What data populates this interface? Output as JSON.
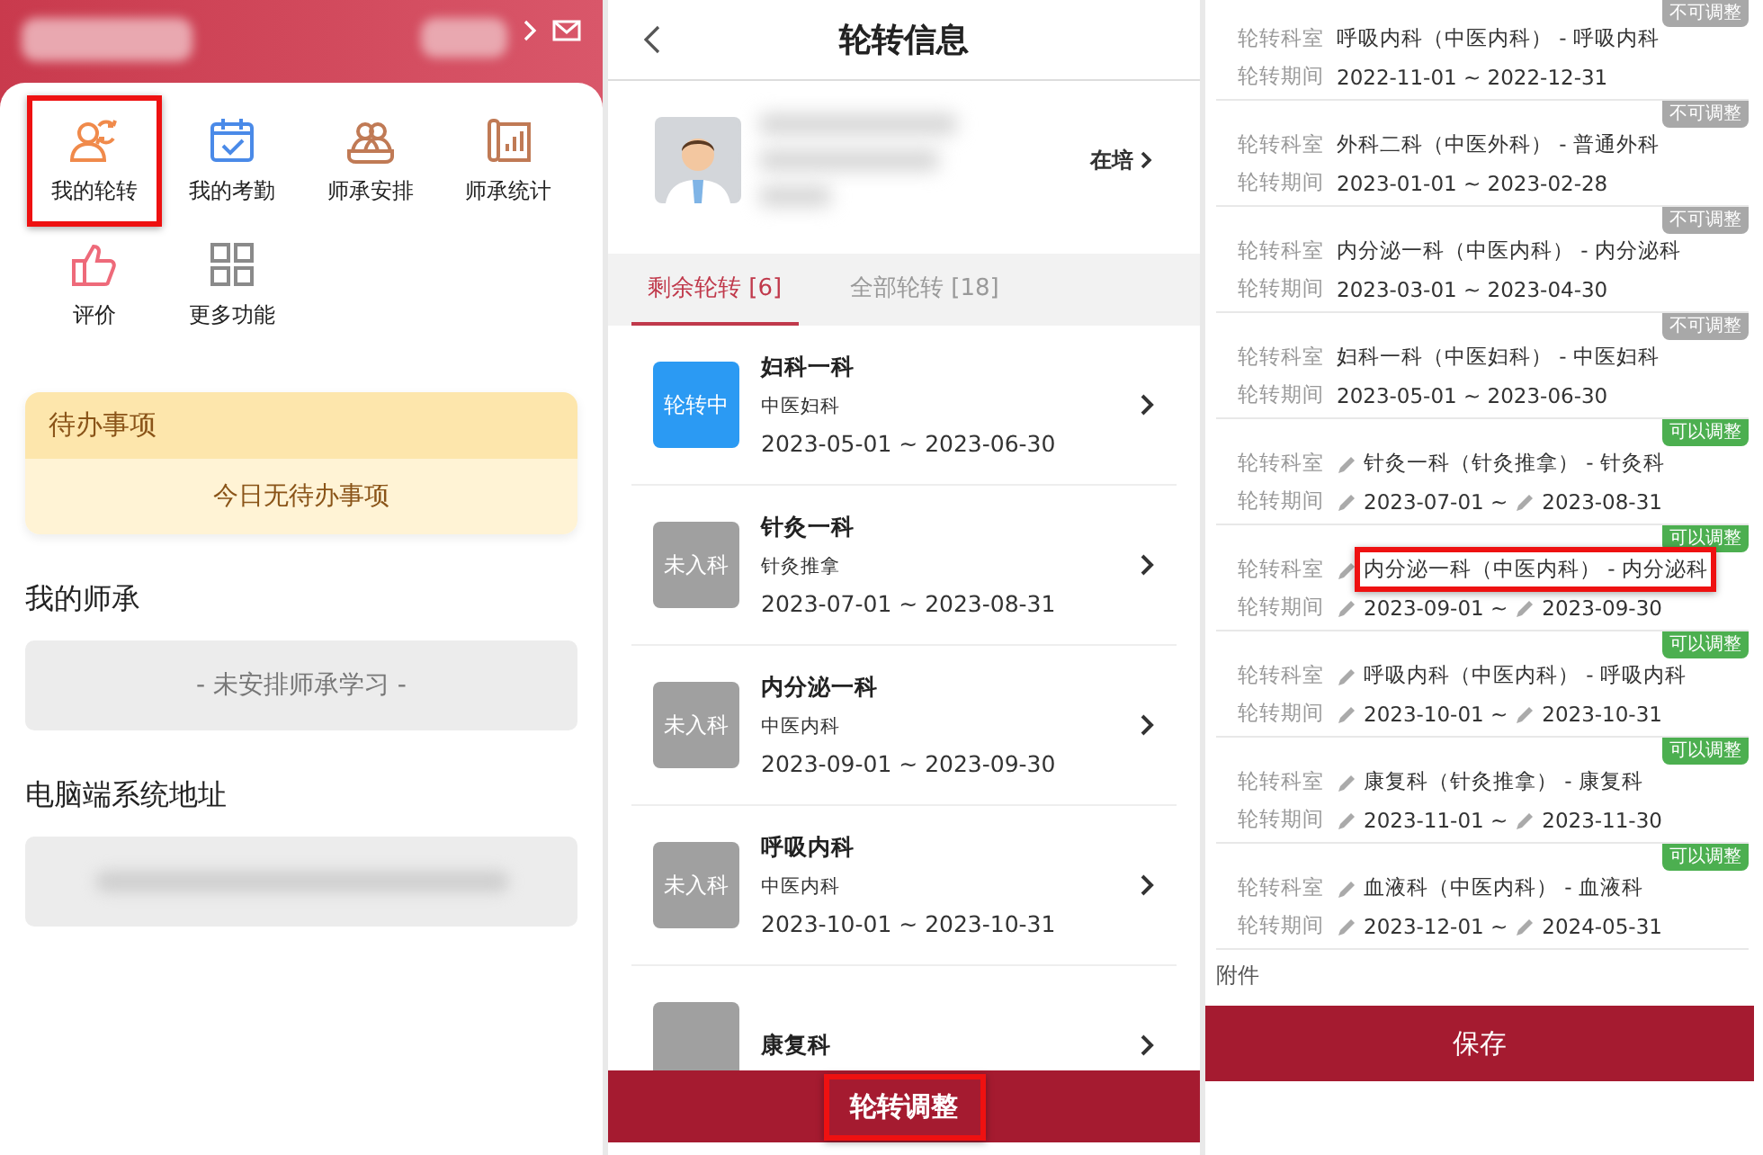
{
  "home": {
    "quick_actions": [
      {
        "label": "我的轮转",
        "highlighted": true
      },
      {
        "label": "我的考勤",
        "highlighted": false
      },
      {
        "label": "师承安排",
        "highlighted": false
      },
      {
        "label": "师承统计",
        "highlighted": false
      },
      {
        "label": "评价",
        "highlighted": false
      },
      {
        "label": "更多功能",
        "highlighted": false
      }
    ],
    "todo": {
      "title": "待办事项",
      "message": "今日无待办事项"
    },
    "mentorship": {
      "title": "我的师承",
      "message": "- 未安排师承学习 -"
    },
    "pc_address": {
      "title": "电脑端系统地址"
    }
  },
  "rotation_info": {
    "title": "轮转信息",
    "status_link": "在培",
    "tabs": [
      {
        "label": "剩余轮转 [6]",
        "selected": true
      },
      {
        "label": "全部轮转 [18]",
        "selected": false
      }
    ],
    "items": [
      {
        "kind": "current",
        "status_label": "轮转中",
        "name": "妇科一科",
        "category": "中医妇科",
        "period": "2023-05-01 ~ 2023-06-30"
      },
      {
        "kind": "pending",
        "status_label": "未入科",
        "name": "针灸一科",
        "category": "针灸推拿",
        "period": "2023-07-01 ~ 2023-08-31"
      },
      {
        "kind": "pending",
        "status_label": "未入科",
        "name": "内分泌一科",
        "category": "中医内科",
        "period": "2023-09-01 ~ 2023-09-30"
      },
      {
        "kind": "pending",
        "status_label": "未入科",
        "name": "呼吸内科",
        "category": "中医内科",
        "period": "2023-10-01 ~ 2023-10-31"
      },
      {
        "kind": "pending",
        "name": "康复科"
      }
    ],
    "adjust_button": {
      "label": "轮转调整",
      "highlighted": true
    }
  },
  "rotation_adjust": {
    "rows": [
      {
        "adjustable": false,
        "badge": "不可调整",
        "dept_label": "轮转科室",
        "dept": "呼吸内科（中医内科） - 呼吸内科",
        "period_label": "轮转期间",
        "period": "2022-11-01 ~ 2022-12-31",
        "highlighted": false
      },
      {
        "adjustable": false,
        "badge": "不可调整",
        "dept_label": "轮转科室",
        "dept": "外科二科（中医外科） - 普通外科",
        "period_label": "轮转期间",
        "period": "2023-01-01 ~ 2023-02-28",
        "highlighted": false
      },
      {
        "adjustable": false,
        "badge": "不可调整",
        "dept_label": "轮转科室",
        "dept": "内分泌一科（中医内科） - 内分泌科",
        "period_label": "轮转期间",
        "period": "2023-03-01 ~ 2023-04-30",
        "highlighted": false
      },
      {
        "adjustable": false,
        "badge": "不可调整",
        "dept_label": "轮转科室",
        "dept": "妇科一科（中医妇科） - 中医妇科",
        "period_label": "轮转期间",
        "period": "2023-05-01 ~ 2023-06-30",
        "highlighted": false
      },
      {
        "adjustable": true,
        "badge": "可以调整",
        "dept_label": "轮转科室",
        "dept": "针灸一科（针灸推拿） - 针灸科",
        "period_label": "轮转期间",
        "period_parts": [
          "2023-07-01 ~",
          "2023-08-31"
        ],
        "highlighted": false
      },
      {
        "adjustable": true,
        "badge": "可以调整",
        "dept_label": "轮转科室",
        "dept": "内分泌一科（中医内科） - 内分泌科",
        "period_label": "轮转期间",
        "period_parts": [
          "2023-09-01 ~",
          "2023-09-30"
        ],
        "highlighted": true
      },
      {
        "adjustable": true,
        "badge": "可以调整",
        "dept_label": "轮转科室",
        "dept": "呼吸内科（中医内科） - 呼吸内科",
        "period_label": "轮转期间",
        "period_parts": [
          "2023-10-01 ~",
          "2023-10-31"
        ],
        "highlighted": false
      },
      {
        "adjustable": true,
        "badge": "可以调整",
        "dept_label": "轮转科室",
        "dept": "康复科（针灸推拿） - 康复科",
        "period_label": "轮转期间",
        "period_parts": [
          "2023-11-01 ~",
          "2023-11-30"
        ],
        "highlighted": false
      },
      {
        "adjustable": true,
        "badge": "可以调整",
        "dept_label": "轮转科室",
        "dept": "血液科（中医内科） - 血液科",
        "period_label": "轮转期间",
        "period_parts": [
          "2023-12-01 ~",
          "2024-05-31"
        ],
        "highlighted": false
      }
    ],
    "attachments_label": "附件",
    "save_button": "保存"
  }
}
